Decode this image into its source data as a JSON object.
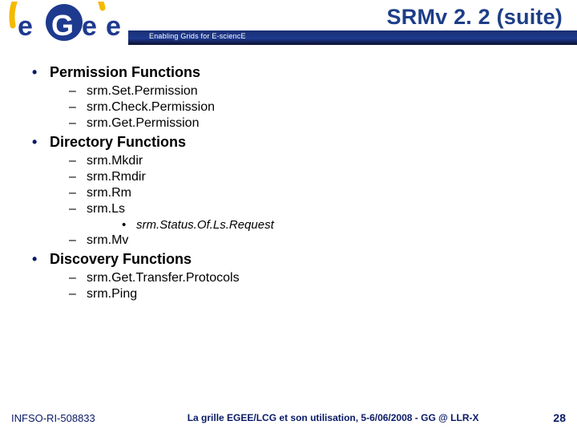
{
  "header": {
    "title": "SRMv 2. 2 (suite)",
    "tagline": "Enabling Grids for E-sciencE",
    "logo_alt": "eGee"
  },
  "outline": [
    {
      "label": "Permission Functions",
      "children": [
        {
          "label": "srm.Set.Permission"
        },
        {
          "label": "srm.Check.Permission"
        },
        {
          "label": "srm.Get.Permission"
        }
      ]
    },
    {
      "label": "Directory Functions",
      "children": [
        {
          "label": "srm.Mkdir"
        },
        {
          "label": "srm.Rmdir"
        },
        {
          "label": "srm.Rm"
        },
        {
          "label": "srm.Ls",
          "children": [
            {
              "label": "srm.Status.Of.Ls.Request"
            }
          ]
        },
        {
          "label": "srm.Mv"
        }
      ]
    },
    {
      "label": "Discovery Functions",
      "children": [
        {
          "label": "srm.Get.Transfer.Protocols"
        },
        {
          "label": "srm.Ping"
        }
      ]
    }
  ],
  "footer": {
    "left": "INFSO-RI-508833",
    "center": "La grille EGEE/LCG et son utilisation, 5-6/06/2008 - GG @ LLR-X",
    "page": "28"
  }
}
